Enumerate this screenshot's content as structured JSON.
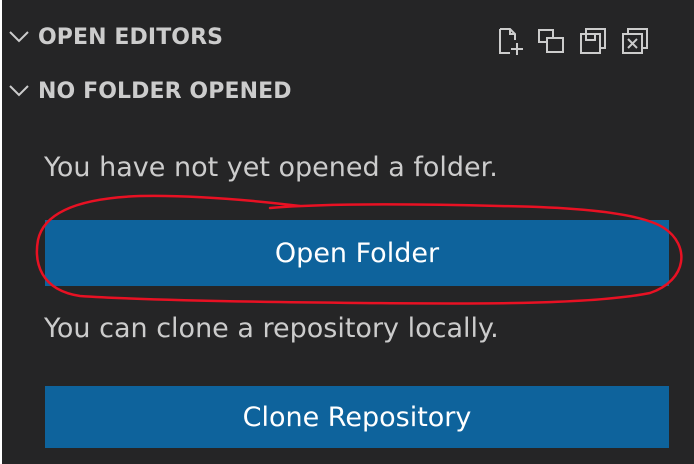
{
  "sections": {
    "open_editors": {
      "title": "OPEN EDITORS",
      "chevron_icon": "chevron-down-icon",
      "actions": [
        {
          "icon": "new-untitled-file-icon"
        },
        {
          "icon": "toggle-vertical-layout-icon"
        },
        {
          "icon": "save-all-icon"
        },
        {
          "icon": "close-all-editors-icon"
        }
      ]
    },
    "no_folder": {
      "title": "NO FOLDER OPENED",
      "chevron_icon": "chevron-down-icon"
    }
  },
  "welcome": {
    "folder_message": "You have not yet opened a folder.",
    "open_folder_label": "Open Folder",
    "clone_message": "You can clone a repository locally.",
    "clone_repository_label": "Clone Repository"
  },
  "colors": {
    "sidebar_background": "#252526",
    "button_background": "#0e639c",
    "text": "#cccccc",
    "annotation": "#e81123"
  }
}
